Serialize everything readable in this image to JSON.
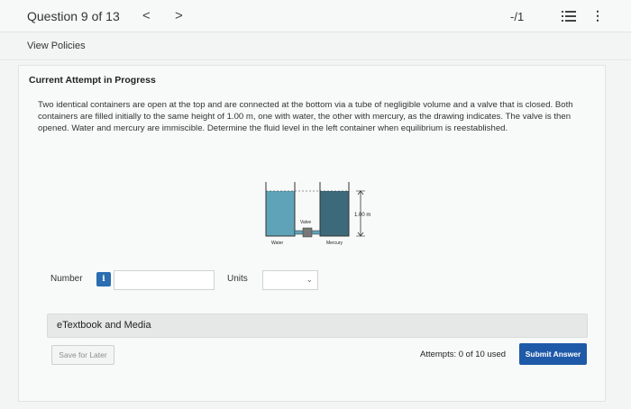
{
  "header": {
    "question_label": "Question 9 of 13",
    "prev_glyph": "<",
    "next_glyph": ">",
    "score": "-/1",
    "icons": [
      "list-icon",
      "more-vertical-icon"
    ]
  },
  "policies_link": "View Policies",
  "attempt_status": "Current Attempt in Progress",
  "question_text": "Two identical containers are open at the top and are connected at the bottom via a tube of negligible volume and a valve that is closed. Both containers are filled initially to the same height of 1.00 m, one with water, the other with mercury, as the drawing indicates. The valve is then opened. Water and mercury are immiscible. Determine the fluid level in the left container when equilibrium is reestablished.",
  "diagram": {
    "height_label": "1.00 m",
    "valve_label": "Valve",
    "water_label": "Water",
    "mercury_label": "Mercury",
    "water_color": "#5fa3b8",
    "mercury_color": "#3c6a7a"
  },
  "answer": {
    "number_label": "Number",
    "info_glyph": "i",
    "number_value": "",
    "units_label": "Units",
    "units_value": ""
  },
  "etextbook_label": "eTextbook and Media",
  "footer": {
    "save_label": "Save for Later",
    "attempts_text": "Attempts: 0 of 10 used",
    "submit_label": "Submit Answer"
  },
  "colors": {
    "accent": "#1f5aa8",
    "info": "#2a6db0"
  }
}
